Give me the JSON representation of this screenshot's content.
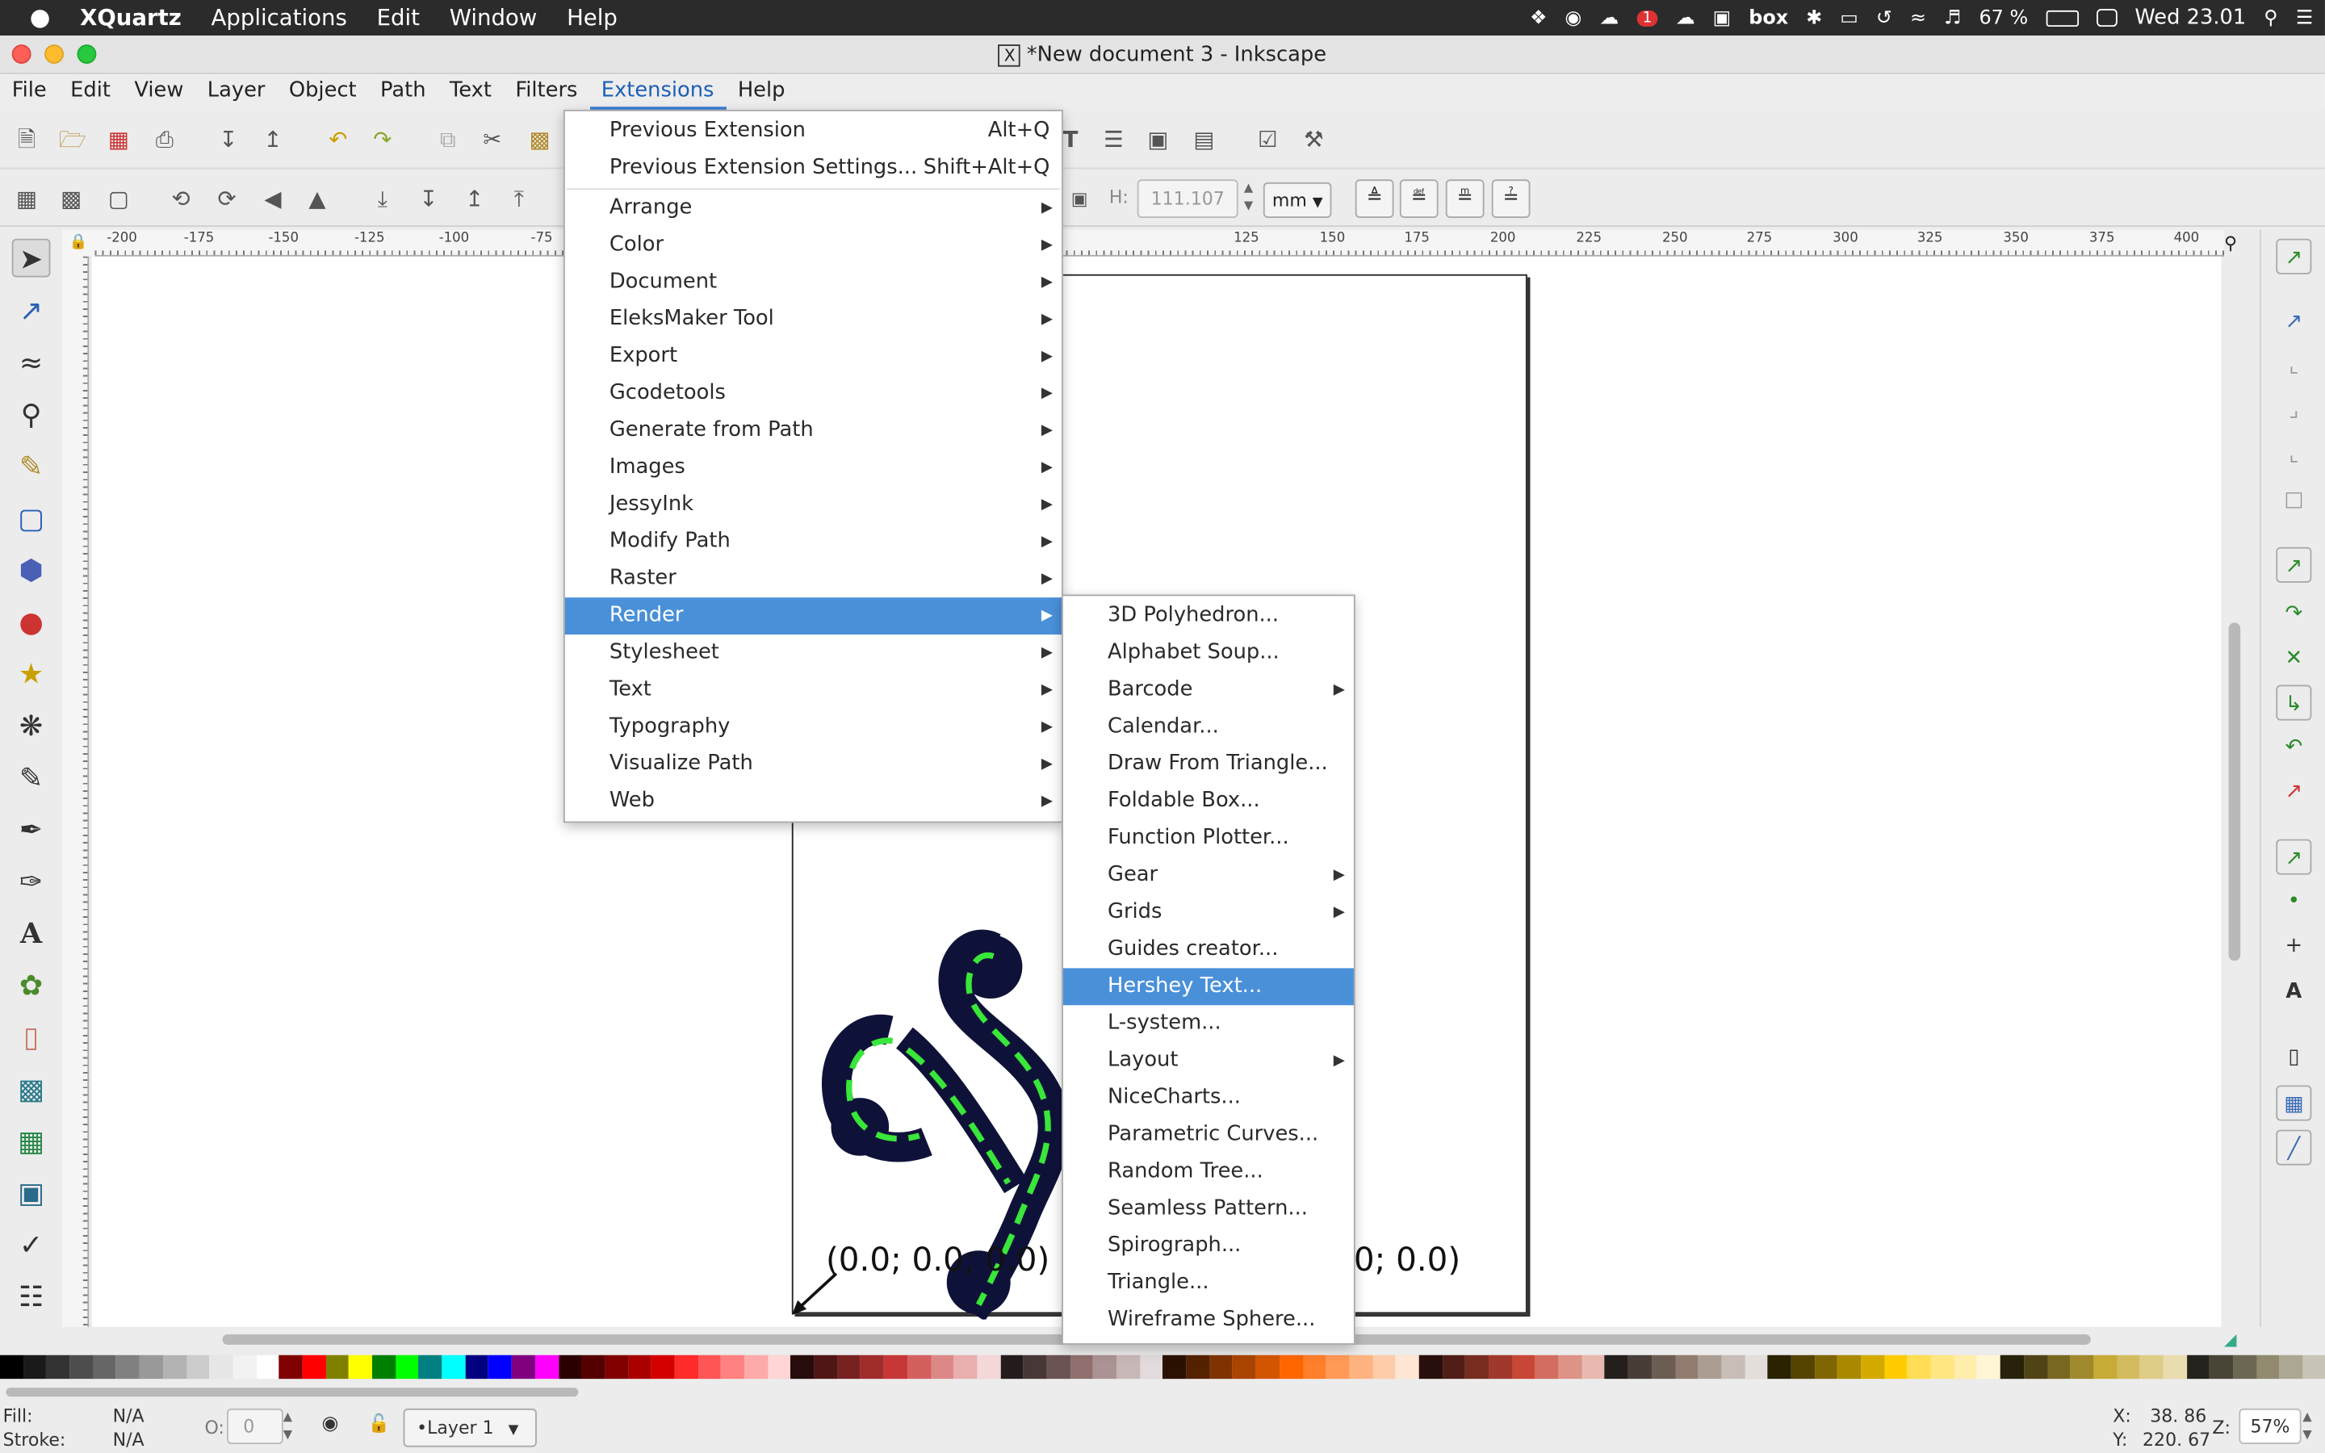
{
  "mac_menubar": {
    "app": "XQuartz",
    "items": [
      "Applications",
      "Edit",
      "Window",
      "Help"
    ],
    "battery": "67 %",
    "clock": "Wed 23.01",
    "box_label": "box",
    "badge": "1"
  },
  "window": {
    "title": "*New document 3 - Inkscape",
    "x_glyph": "X"
  },
  "menubar": [
    "File",
    "Edit",
    "View",
    "Layer",
    "Object",
    "Path",
    "Text",
    "Filters",
    "Extensions",
    "Help"
  ],
  "toolbar2": {
    "h_label": "H:",
    "h_value": "111.107",
    "unit": "mm"
  },
  "ruler_top": [
    "-200",
    "-175",
    "-150",
    "-125",
    "-100",
    "-75",
    "125",
    "150",
    "175",
    "200",
    "225",
    "250",
    "275",
    "300",
    "325",
    "350",
    "375",
    "400"
  ],
  "canvas": {
    "coord_left": "(0.0; 0.0; 0.0)",
    "coord_right": "0; 0.0)"
  },
  "extensions_menu": {
    "items": [
      {
        "label": "Previous Extension",
        "shortcut": "Alt+Q"
      },
      {
        "label": "Previous Extension Settings...",
        "shortcut": "Shift+Alt+Q"
      },
      {
        "label": "Arrange",
        "submenu": true
      },
      {
        "label": "Color",
        "submenu": true
      },
      {
        "label": "Document",
        "submenu": true
      },
      {
        "label": "EleksMaker Tool",
        "submenu": true
      },
      {
        "label": "Export",
        "submenu": true
      },
      {
        "label": "Gcodetools",
        "submenu": true
      },
      {
        "label": "Generate from Path",
        "submenu": true
      },
      {
        "label": "Images",
        "submenu": true
      },
      {
        "label": "JessyInk",
        "submenu": true
      },
      {
        "label": "Modify Path",
        "submenu": true
      },
      {
        "label": "Raster",
        "submenu": true
      },
      {
        "label": "Render",
        "submenu": true,
        "highlighted": true
      },
      {
        "label": "Stylesheet",
        "submenu": true
      },
      {
        "label": "Text",
        "submenu": true
      },
      {
        "label": "Typography",
        "submenu": true
      },
      {
        "label": "Visualize Path",
        "submenu": true
      },
      {
        "label": "Web",
        "submenu": true
      }
    ]
  },
  "render_submenu": {
    "items": [
      {
        "label": "3D Polyhedron..."
      },
      {
        "label": "Alphabet Soup..."
      },
      {
        "label": "Barcode",
        "submenu": true
      },
      {
        "label": "Calendar..."
      },
      {
        "label": "Draw From Triangle..."
      },
      {
        "label": "Foldable Box..."
      },
      {
        "label": "Function Plotter..."
      },
      {
        "label": "Gear",
        "submenu": true
      },
      {
        "label": "Grids",
        "submenu": true
      },
      {
        "label": "Guides creator..."
      },
      {
        "label": "Hershey Text...",
        "highlighted": true
      },
      {
        "label": "L-system..."
      },
      {
        "label": "Layout",
        "submenu": true
      },
      {
        "label": "NiceCharts..."
      },
      {
        "label": "Parametric Curves..."
      },
      {
        "label": "Random Tree..."
      },
      {
        "label": "Seamless Pattern..."
      },
      {
        "label": "Spirograph..."
      },
      {
        "label": "Triangle..."
      },
      {
        "label": "Wireframe Sphere..."
      }
    ]
  },
  "statusbar": {
    "fill_label": "Fill:",
    "fill_value": "N/A",
    "stroke_label": "Stroke:",
    "stroke_value": "N/A",
    "opacity_label": "O:",
    "opacity_value": "0",
    "layer": "•Layer 1",
    "x_label": "X:",
    "x_value": "38. 86",
    "y_label": "Y:",
    "y_value": "220. 67",
    "zoom_label": "Z:",
    "zoom_value": "57%"
  },
  "colors": {
    "accent": "#4a90d9",
    "menu_active_text": "#1b5fb6"
  }
}
